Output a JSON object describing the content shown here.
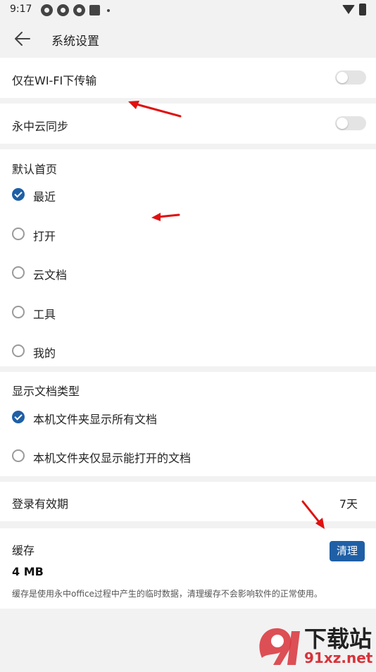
{
  "status_bar": {
    "time": "9:17",
    "notification_icons": [
      "notification-icon",
      "notification-icon",
      "notification-icon",
      "notification-square-icon"
    ],
    "right_icons": [
      "wifi-icon",
      "battery-icon"
    ]
  },
  "header": {
    "title": "系统设置",
    "back_icon": "back-arrow-icon"
  },
  "settings": {
    "wifi_only": {
      "label": "仅在WI-FI下传输",
      "enabled": false
    },
    "cloud_sync": {
      "label": "永中云同步",
      "enabled": false
    }
  },
  "default_home": {
    "title": "默认首页",
    "options": [
      "最近",
      "打开",
      "云文档",
      "工具",
      "我的"
    ],
    "selected_index": 0
  },
  "doc_types": {
    "title": "显示文档类型",
    "options": [
      "本机文件夹显示所有文档",
      "本机文件夹仅显示能打开的文档"
    ],
    "selected_index": 0
  },
  "login_validity": {
    "label": "登录有效期",
    "value": "7天"
  },
  "cache": {
    "title": "缓存",
    "button_label": "清理",
    "size": "4 MB",
    "description": "缓存是使用永中office过程中产生的临时数据，清理缓存不会影响软件的正常使用。"
  },
  "watermark": {
    "text": "下载站",
    "url_text": "91xz.net"
  },
  "colors": {
    "accent": "#1f5fa6",
    "annotation_arrow": "#e01010",
    "background": "#f2f2f2"
  }
}
